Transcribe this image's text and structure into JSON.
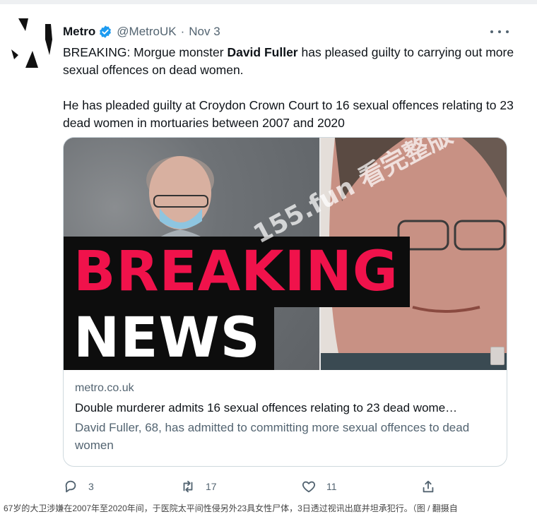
{
  "tweet": {
    "name": "Metro",
    "handle": "@MetroUK",
    "separator": "·",
    "date": "Nov 3",
    "text_line1_prefix": "BREAKING: Morgue monster ",
    "text_line1_bold": "David Fuller",
    "text_line1_suffix": " has pleased guilty to carrying out more sexual offences on dead women.",
    "text_paragraph2": "He has pleaded guilty at Croydon Crown Court to 16 sexual offences relating to 23 dead women in mortuaries between 2007 and 2020"
  },
  "card": {
    "banner_line1": "BREAKING",
    "banner_line2": "NEWS",
    "watermark": "155.fun 看完整版",
    "domain": "metro.co.uk",
    "title": "Double murderer admits 16 sexual offences relating to 23 dead wome…",
    "description": "David Fuller, 68, has admitted to committing more sexual offences to dead women"
  },
  "actions": {
    "replies": "3",
    "retweets": "17",
    "likes": "11"
  },
  "icons": {
    "verified": "verified-badge-icon",
    "more": "more-options-icon",
    "reply": "reply-icon",
    "retweet": "retweet-icon",
    "like": "heart-icon",
    "share": "share-icon"
  },
  "colors": {
    "breaking_red": "#f0124b",
    "verified_blue": "#1d9bf0",
    "muted_text": "#536471"
  },
  "caption": "67岁的大卫涉嫌在2007年至2020年间，于医院太平间性侵另外23具女性尸体，3日透过视讯出庭并坦承犯行。（图 / 翻摄自"
}
